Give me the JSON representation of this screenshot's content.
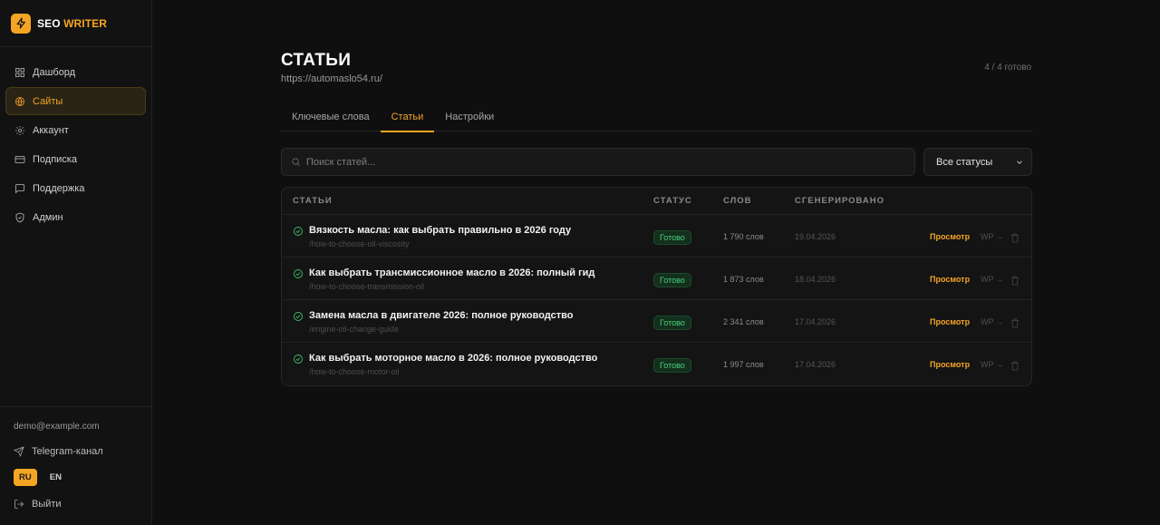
{
  "brand": {
    "part1": "SEO",
    "part2": "WRITER",
    "logo_icon": "bolt-icon"
  },
  "nav": {
    "items": [
      {
        "label": "Дашборд",
        "icon": "dashboard-icon"
      },
      {
        "label": "Сайты",
        "icon": "globe-icon",
        "active": true
      },
      {
        "label": "Аккаунт",
        "icon": "gear-icon"
      },
      {
        "label": "Подписка",
        "icon": "card-icon"
      },
      {
        "label": "Поддержка",
        "icon": "chat-icon"
      },
      {
        "label": "Админ",
        "icon": "shield-icon"
      }
    ]
  },
  "sidebar_bottom": {
    "email": "demo@example.com",
    "telegram_label": "Telegram-канал",
    "lang_ru": "RU",
    "lang_en": "EN",
    "logout_label": "Выйти"
  },
  "header": {
    "title": "СТАТЬИ",
    "url": "https://automaslo54.ru/",
    "progress": "4 / 4 готово"
  },
  "tabs": [
    {
      "label": "Ключевые слова",
      "active": false
    },
    {
      "label": "Статьи",
      "active": true
    },
    {
      "label": "Настройки",
      "active": false
    }
  ],
  "search": {
    "placeholder": "Поиск статей..."
  },
  "filter": {
    "selected": "Все статусы"
  },
  "table": {
    "headers": {
      "articles": "СТАТЬИ",
      "status": "СТАТУС",
      "words": "СЛОВ",
      "generated": "СГЕНЕРИРОВАНО"
    },
    "rows": [
      {
        "title": "Вязкость масла: как выбрать правильно в 2026 году",
        "slug": "/how-to-choose-oil-viscosity",
        "status": "Готово",
        "words": "1 790 слов",
        "date": "19.04.2026",
        "view": "Просмотр",
        "wp": "WP →"
      },
      {
        "title": "Как выбрать трансмиссионное масло в 2026: полный гид",
        "slug": "/how-to-choose-transmission-oil",
        "status": "Готово",
        "words": "1 873 слов",
        "date": "18.04.2026",
        "view": "Просмотр",
        "wp": "WP →"
      },
      {
        "title": "Замена масла в двигателе 2026: полное руководство",
        "slug": "/engine-oil-change-guide",
        "status": "Готово",
        "words": "2 341 слов",
        "date": "17.04.2026",
        "view": "Просмотр",
        "wp": "WP →"
      },
      {
        "title": "Как выбрать моторное масло в 2026: полное руководство",
        "slug": "/how-to-choose-motor-oil",
        "status": "Готово",
        "words": "1 997 слов",
        "date": "17.04.2026",
        "view": "Просмотр",
        "wp": "WP →"
      }
    ]
  },
  "colors": {
    "accent": "#f5a524",
    "success": "#4ccf7a",
    "background": "#0f0f0f"
  }
}
